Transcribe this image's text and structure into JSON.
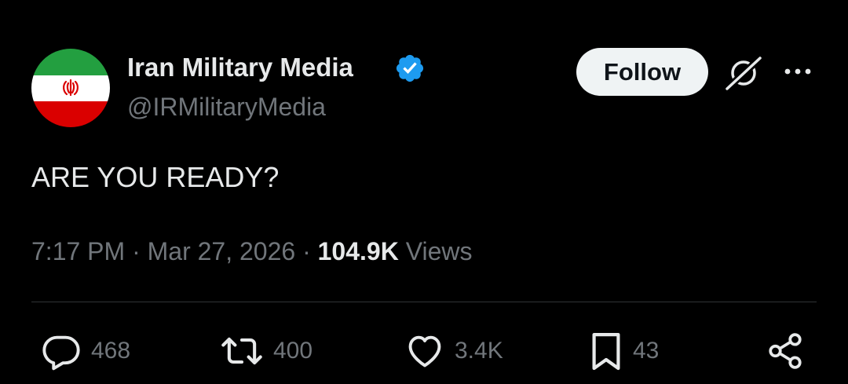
{
  "tweet": {
    "author": {
      "display_name": "Iran Military Media",
      "handle": "@IRMilitaryMedia",
      "verified_icon": "verified-badge-icon",
      "avatar": "iran-flag-avatar"
    },
    "follow_label": "Follow",
    "text": "ARE YOU READY?",
    "time": "7:17 PM",
    "separator": " · ",
    "date": "Mar 27, 2026",
    "views_count": "104.9K",
    "views_label": "Views"
  },
  "actions": {
    "reply": {
      "icon": "reply-icon",
      "count": "468"
    },
    "retweet": {
      "icon": "retweet-icon",
      "count": "400"
    },
    "like": {
      "icon": "heart-icon",
      "count": "3.4K"
    },
    "bookmark": {
      "icon": "bookmark-icon",
      "count": "43"
    },
    "share": {
      "icon": "share-icon"
    }
  },
  "colors": {
    "background": "#000000",
    "primary_text": "#e7e9ea",
    "secondary_text": "#71767b",
    "verified_blue": "#1d9bf0",
    "follow_bg": "#eff3f4",
    "divider": "#2f3336",
    "flag_green": "#239f40",
    "flag_white": "#ffffff",
    "flag_red": "#da0000"
  }
}
